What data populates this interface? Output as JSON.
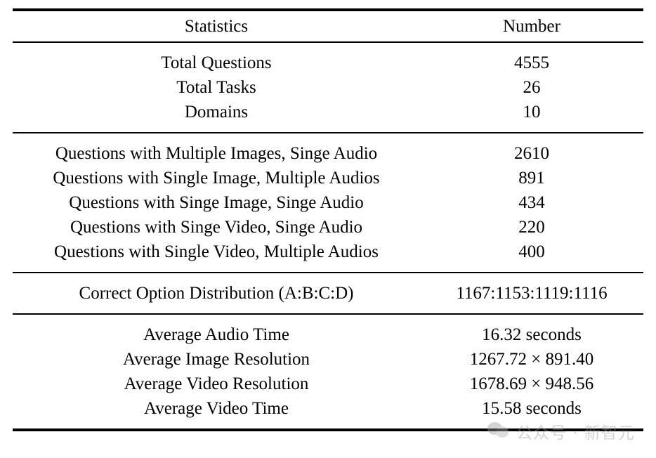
{
  "table": {
    "columns": [
      "Statistics",
      "Number"
    ],
    "sections": [
      {
        "name": "overview",
        "rows": [
          {
            "statistic": "Total Questions",
            "number": "4555"
          },
          {
            "statistic": "Total Tasks",
            "number": "26"
          },
          {
            "statistic": "Domains",
            "number": "10"
          }
        ]
      },
      {
        "name": "modality-breakdown",
        "rows": [
          {
            "statistic": "Questions with Multiple Images, Singe Audio",
            "number": "2610"
          },
          {
            "statistic": "Questions with Single Image, Multiple Audios",
            "number": "891"
          },
          {
            "statistic": "Questions with Singe Image, Singe Audio",
            "number": "434"
          },
          {
            "statistic": "Questions with Singe Video, Singe Audio",
            "number": "220"
          },
          {
            "statistic": "Questions with Single Video, Multiple Audios",
            "number": "400"
          }
        ]
      },
      {
        "name": "answer-distribution",
        "rows": [
          {
            "statistic": "Correct Option Distribution (A:B:C:D)",
            "number": "1167:1153:1119:1116"
          }
        ]
      },
      {
        "name": "averages",
        "rows": [
          {
            "statistic": "Average Audio Time",
            "number": "16.32 seconds"
          },
          {
            "statistic": "Average Image Resolution",
            "number": "1267.72 × 891.40"
          },
          {
            "statistic": "Average Video Resolution",
            "number": "1678.69 × 948.56"
          },
          {
            "statistic": "Average Video Time",
            "number": "15.58 seconds"
          }
        ]
      }
    ]
  },
  "watermark": {
    "text": "公众号 · 新智元",
    "icon": "wechat-logo-icon",
    "color": "#9a9a9a"
  }
}
